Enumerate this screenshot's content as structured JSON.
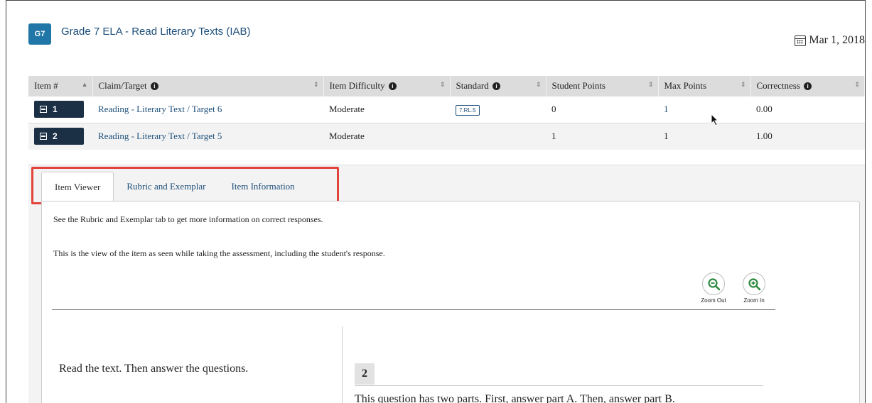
{
  "header": {
    "grade_badge": "G7",
    "title": "Grade 7 ELA - Read Literary Texts (IAB)",
    "date": "Mar 1, 2018"
  },
  "table": {
    "columns": [
      "Item #",
      "Claim/Target",
      "Item Difficulty",
      "Standard",
      "Student Points",
      "Max Points",
      "Correctness"
    ],
    "rows": [
      {
        "item": "1",
        "claim_target": "Reading - Literary Text / Target 6",
        "difficulty": "Moderate",
        "standard": "7.RL.5",
        "student_points": "0",
        "max_points": "1",
        "correctness": "0.00"
      },
      {
        "item": "2",
        "claim_target": "Reading - Literary Text / Target 5",
        "difficulty": "Moderate",
        "standard": "",
        "student_points": "1",
        "max_points": "1",
        "correctness": "1.00"
      }
    ]
  },
  "tabs": [
    "Item Viewer",
    "Rubric and Exemplar",
    "Item Information"
  ],
  "viewer": {
    "note_rubric": "See the Rubric and Exemplar tab to get more information on correct responses.",
    "note_view": "This is the view of the item as seen while taking the assessment, including the student's response.",
    "zoom_out_label": "Zoom Out",
    "zoom_in_label": "Zoom In",
    "passage_instruction": "Read the text. Then answer the questions.",
    "question_number": "2",
    "question_text": "This question has two parts. First, answer part A. Then, answer part B."
  },
  "colors": {
    "badge": "#2176a8",
    "item_button": "#1b2f45",
    "link": "#1d4f7a",
    "highlight": "#e0443a"
  }
}
